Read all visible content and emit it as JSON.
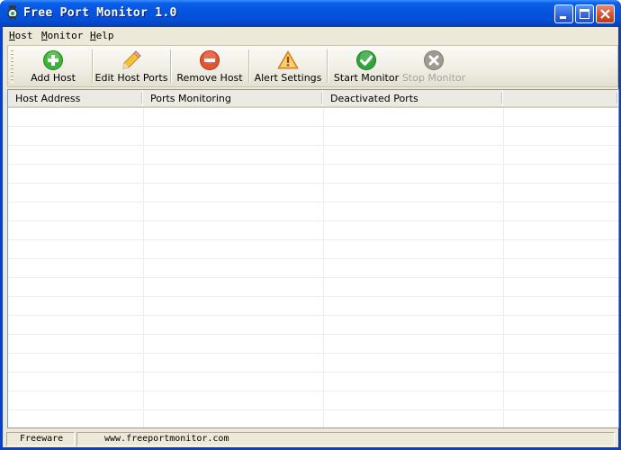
{
  "window": {
    "title": "Free Port Monitor 1.0"
  },
  "menu": [
    {
      "underline": "H",
      "rest": "ost"
    },
    {
      "underline": "M",
      "rest": "onitor"
    },
    {
      "underline": "H",
      "rest": "elp"
    }
  ],
  "toolbar": {
    "add_host": "Add Host",
    "edit_host_ports": "Edit Host Ports",
    "remove_host": "Remove Host",
    "alert_settings": "Alert Settings",
    "start_monitor": "Start Monitor",
    "stop_monitor": "Stop Monitor"
  },
  "table": {
    "columns": [
      "Host Address",
      "Ports Monitoring",
      "Deactivated Ports",
      ""
    ],
    "rows": []
  },
  "status": {
    "left": "Freeware",
    "url": "www.freeportmonitor.com"
  },
  "colors": {
    "titlebar": "#0654E0",
    "add_icon": "#3DB23A",
    "remove_icon": "#E2552D",
    "alert_icon": "#F2A52B",
    "start_icon": "#2EA53A",
    "stop_icon": "#9D9B92"
  }
}
